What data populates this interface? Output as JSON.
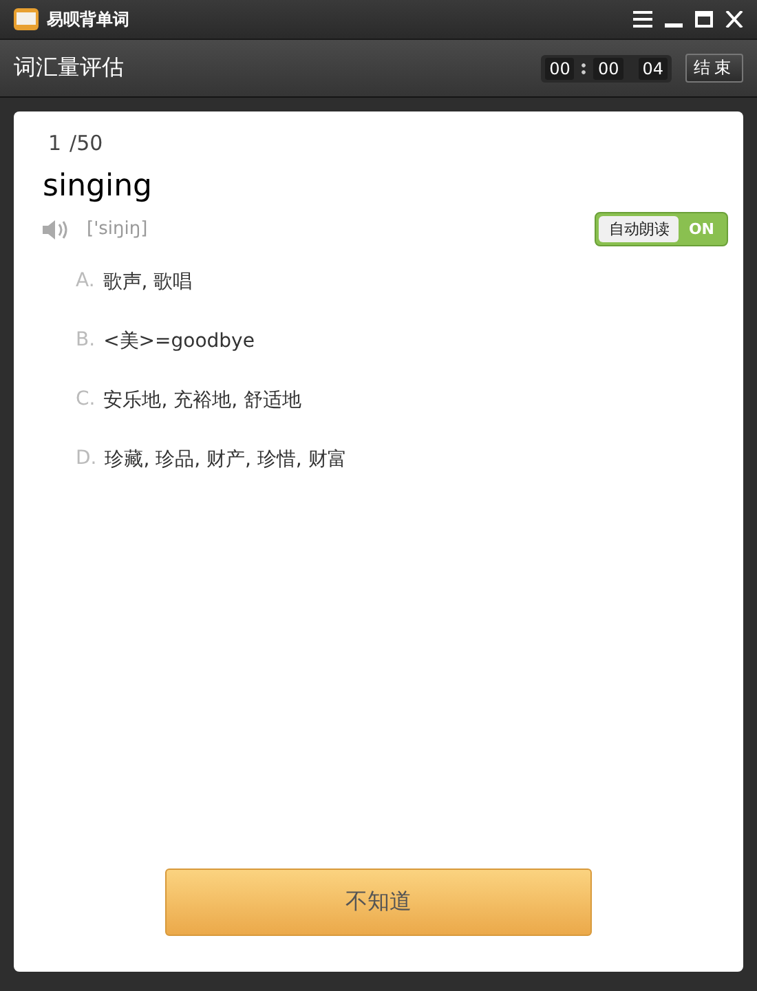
{
  "window": {
    "title": "易呗背单词"
  },
  "header": {
    "title": "词汇量评估",
    "timer": [
      "00",
      "00",
      "04"
    ],
    "end_button": "结束"
  },
  "question": {
    "progress": "1",
    "total": "/50",
    "word": "singing",
    "phonetic": "['siŋiŋ]",
    "auto_read": {
      "label": "自动朗读",
      "state_text": "ON",
      "on": true
    }
  },
  "options": [
    {
      "letter": "A.",
      "text": "歌声, 歌唱"
    },
    {
      "letter": "B.",
      "text": "<美>=goodbye"
    },
    {
      "letter": "C.",
      "text": "安乐地, 充裕地, 舒适地"
    },
    {
      "letter": "D.",
      "text": "珍藏, 珍品, 财产, 珍惜, 财富"
    }
  ],
  "dont_know_button": "不知道"
}
